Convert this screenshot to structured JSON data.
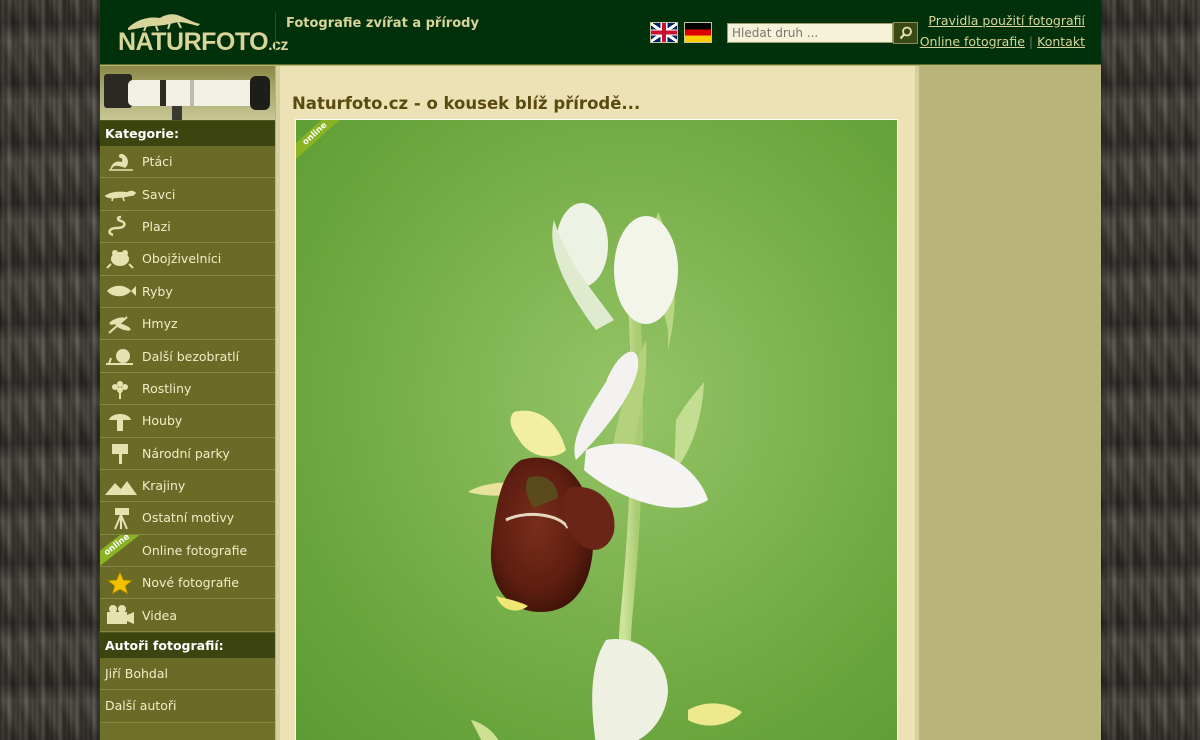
{
  "header": {
    "logo_main": "NATURFOTO",
    "logo_suffix": ".cz",
    "tagline": "Fotografie zvířat a přírody",
    "search_placeholder": "Hledat druh ...",
    "links": {
      "rules": "Pravidla použití fotografií",
      "online": "Online fotografie",
      "contact": "Kontakt"
    },
    "flags": [
      "flag-uk-icon",
      "flag-de-icon"
    ]
  },
  "sidebar": {
    "categories_heading": "Kategorie:",
    "categories": [
      {
        "label": "Ptáci",
        "icon": "swan-icon"
      },
      {
        "label": "Savci",
        "icon": "mammal-icon"
      },
      {
        "label": "Plazi",
        "icon": "snake-icon"
      },
      {
        "label": "Obojživelníci",
        "icon": "frog-icon"
      },
      {
        "label": "Ryby",
        "icon": "fish-icon"
      },
      {
        "label": "Hmyz",
        "icon": "dragonfly-icon"
      },
      {
        "label": "Další bezobratlí",
        "icon": "snail-icon"
      },
      {
        "label": "Rostliny",
        "icon": "flower-icon"
      },
      {
        "label": "Houby",
        "icon": "mushroom-icon"
      },
      {
        "label": "Národní parky",
        "icon": "signpost-icon"
      },
      {
        "label": "Krajiny",
        "icon": "landscape-icon"
      },
      {
        "label": "Ostatní motivy",
        "icon": "tripod-icon"
      },
      {
        "label": "Online fotografie",
        "icon": "online-ribbon-icon",
        "ribbon": "online"
      },
      {
        "label": "Nové fotografie",
        "icon": "star-icon"
      },
      {
        "label": "Videa",
        "icon": "video-camera-icon"
      }
    ],
    "authors_heading": "Autoři fotografií:",
    "authors": [
      "Jiří Bohdal",
      "Další autoři"
    ]
  },
  "main": {
    "title": "Naturfoto.cz - o kousek blíž přírodě...",
    "photo_ribbon": "online"
  },
  "colors": {
    "header_bg": "#00310a",
    "sidebar_bg": "#6a6b26",
    "content_bg": "#ece2b6",
    "accent_text": "#d8d49a",
    "title_text": "#5a4a10"
  }
}
